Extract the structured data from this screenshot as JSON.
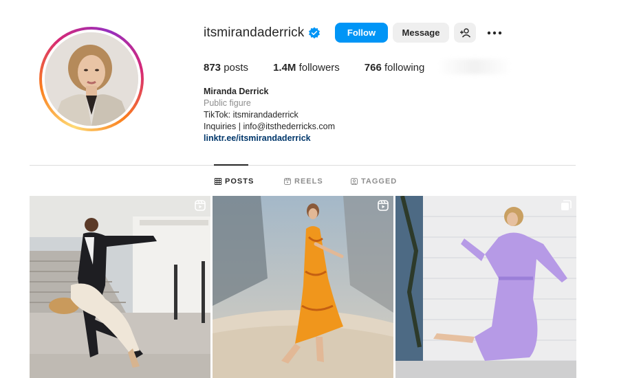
{
  "profile": {
    "username": "itsmirandaderrick",
    "verified": true,
    "follow_label": "Follow",
    "message_label": "Message",
    "suggest_icon": "add-person-icon",
    "more_icon": "more-options-icon"
  },
  "stats": {
    "posts_count": "873",
    "posts_label": "posts",
    "followers_count": "1.4M",
    "followers_label": "followers",
    "following_count": "766",
    "following_label": "following"
  },
  "bio": {
    "name": "Miranda Derrick",
    "category": "Public figure",
    "line1": "TikTok: itsmirandaderrick",
    "line2": "Inquiries | info@itsthederricks.com",
    "link": "linktr.ee/itsmirandaderrick"
  },
  "tabs": [
    {
      "label": "POSTS",
      "icon": "grid-icon",
      "active": true
    },
    {
      "label": "REELS",
      "icon": "reels-icon",
      "active": false
    },
    {
      "label": "TAGGED",
      "icon": "tagged-icon",
      "active": false
    }
  ],
  "posts": [
    {
      "type": "reel",
      "icon": "reel-badge-icon"
    },
    {
      "type": "reel",
      "icon": "reel-badge-icon"
    },
    {
      "type": "carousel",
      "icon": "carousel-badge-icon"
    }
  ],
  "colors": {
    "accent": "#0095f6",
    "link": "#00376b",
    "muted": "#8e8e8e",
    "text": "#262626",
    "button_bg": "#efefef",
    "verified": "#0095f6"
  }
}
